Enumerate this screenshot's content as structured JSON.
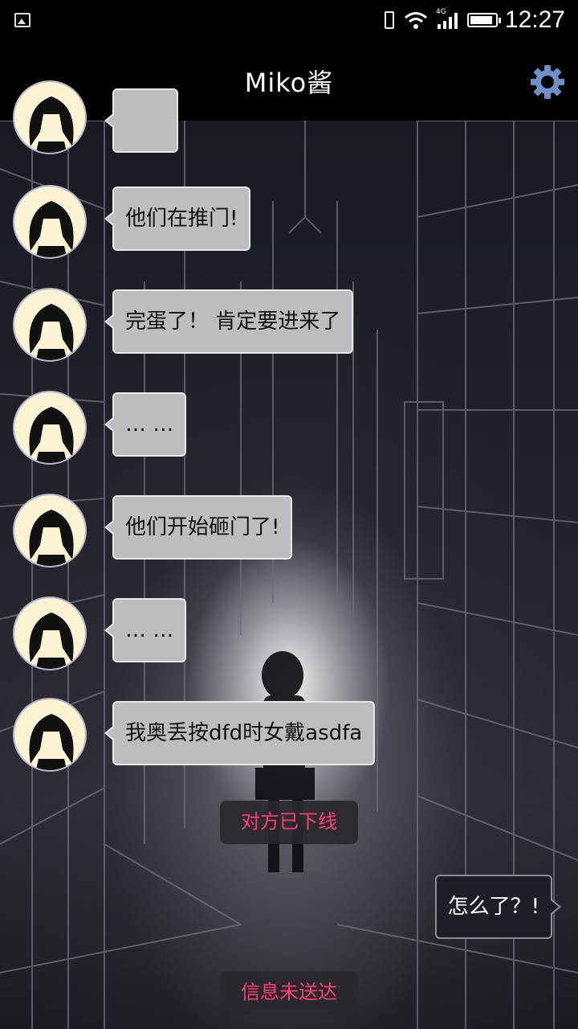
{
  "status_bar": {
    "time": "12:27",
    "network": "4G",
    "battery_level": 0.8,
    "icons": [
      "gallery-icon",
      "vibrate-icon",
      "wifi-icon",
      "signal-icon",
      "battery-icon"
    ]
  },
  "app_bar": {
    "title": "Miko酱",
    "settings_icon": "gear-icon",
    "accent": "#6f8fc7"
  },
  "messages": [
    {
      "from": "miko",
      "text": ""
    },
    {
      "from": "miko",
      "text": "他们在推门!"
    },
    {
      "from": "miko",
      "text": "完蛋了！ 肯定要进来了"
    },
    {
      "from": "miko",
      "text": "… …"
    },
    {
      "from": "miko",
      "text": "他们开始砸门了!"
    },
    {
      "from": "miko",
      "text": "… …"
    },
    {
      "from": "miko",
      "text": "我奥丢按dfd时女戴asdfa"
    },
    {
      "from": "system",
      "text": "对方已下线"
    },
    {
      "from": "me",
      "text": "怎么了？!"
    },
    {
      "from": "system",
      "text": "信息未送达"
    }
  ],
  "colors": {
    "system_text": "#ff3d79",
    "incoming_bubble": "#bdbdbd",
    "outgoing_bubble": "#1e1f26"
  }
}
